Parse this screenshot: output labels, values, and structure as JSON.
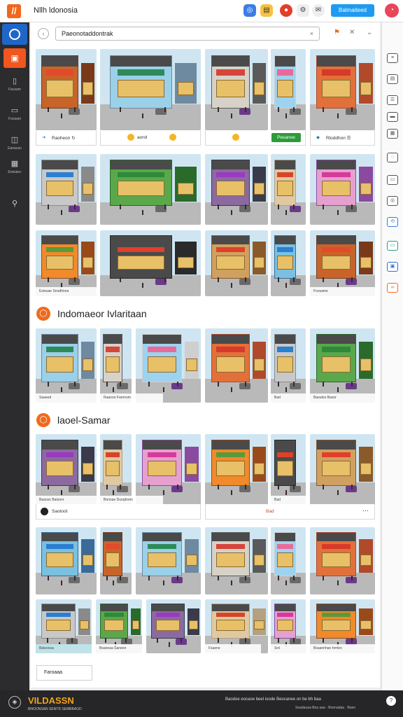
{
  "app": {
    "title": "Nllh ldonosia",
    "logo_glyph": "//"
  },
  "topbar": {
    "primary_button": "Balmaiteed",
    "avatar_glyph": "◔"
  },
  "sidebar": {
    "items": [
      {
        "label": "Facsam",
        "icon": "bookmark-icon"
      },
      {
        "label": "Foosam",
        "icon": "image-icon"
      },
      {
        "label": "Eanacan",
        "icon": "layers-icon"
      },
      {
        "label": "Eneiaiec",
        "icon": "grid-icon"
      },
      {
        "label": "",
        "icon": "settings-icon"
      }
    ]
  },
  "search": {
    "value": "Paeonotaddontrak",
    "clear": "×"
  },
  "captions": {
    "row1": [
      {
        "text": "Raoheon ↻",
        "icon": "arrow-icon"
      },
      {
        "text": "aorol",
        "icon": "coin-icon"
      },
      {
        "text": "",
        "icon": "coin-icon"
      },
      {
        "text": "Pesanoe",
        "icon": "green-badge"
      },
      {
        "text": "Rloddhon ☰",
        "icon": "diamond-icon"
      }
    ],
    "row3": [
      "Esieuae Snodhnea",
      "Foosame"
    ],
    "sec1": [
      "Saaeed",
      "Raanoo Farnnom",
      "Bad",
      "Baoaloo Basor"
    ],
    "sec2_row1": [
      "Baaoso Batsonr",
      "Bonoae Duoqhrem",
      "Bad",
      "Bad"
    ],
    "sec2_cap": "Saotoot",
    "sec2_dots": "⋯",
    "sec3_row": [
      "Batsoosa",
      "Bsaneaa Saneen",
      "Fsaene",
      "Srd",
      "Bsaannhan hrmen"
    ]
  },
  "sections": [
    {
      "title": "Indomaeor Ivlaritaan",
      "badge": "◯"
    },
    {
      "title": "laoel-Samar",
      "badge": "◯"
    }
  ],
  "more": "Faroaaa",
  "footer": {
    "brand": "VILDASSN",
    "sub": "BNOONSAN SENTR SEMBBAOD",
    "meta": "Baodoe eocaoe beel ioode Beocanee on be bh baa",
    "meta2": "Seadaoaa Boa aaa · Bonnadaa · Baen"
  }
}
